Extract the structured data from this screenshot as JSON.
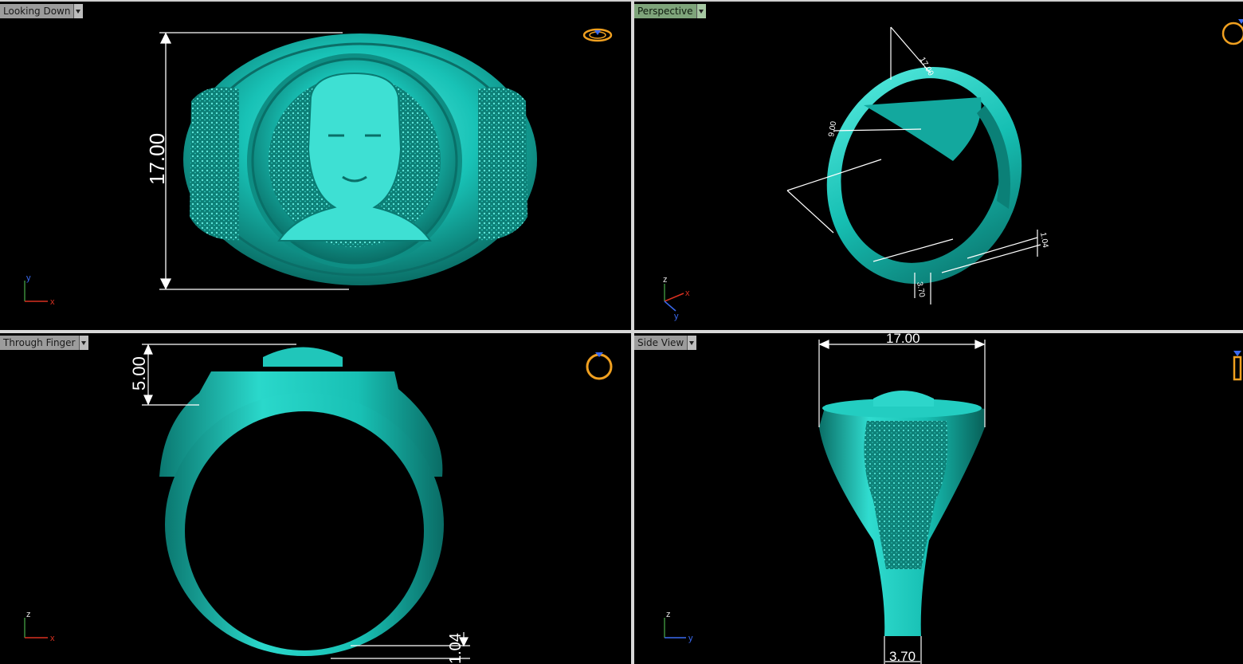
{
  "viewports": {
    "top_left": {
      "label": "Looking Down",
      "dimension": "17.00",
      "axes": [
        "y",
        "x"
      ]
    },
    "top_right": {
      "label": "Perspective",
      "dims": [
        "17.00",
        "9.00",
        "1.04",
        "3.70"
      ],
      "axes": [
        "z",
        "x",
        "y"
      ]
    },
    "bottom_left": {
      "label": "Through Finger",
      "dims": [
        "5.00",
        "1.04"
      ],
      "axes": [
        "z",
        "x"
      ]
    },
    "bottom_right": {
      "label": "Side View",
      "dims": [
        "17.00",
        "3.70"
      ],
      "axes": [
        "z",
        "y"
      ]
    }
  },
  "colors": {
    "ring": "#17c4b8",
    "active_label": "#7ea47a",
    "label_bg": "#9c9c9c",
    "axis_x": "#d83020",
    "axis_y": "#3060e0",
    "axis_z": "#e0e0e0",
    "nav_icon": "#f0a020"
  },
  "icons": [
    "viewport-menu-arrow-icon",
    "ring-nav-icon"
  ]
}
